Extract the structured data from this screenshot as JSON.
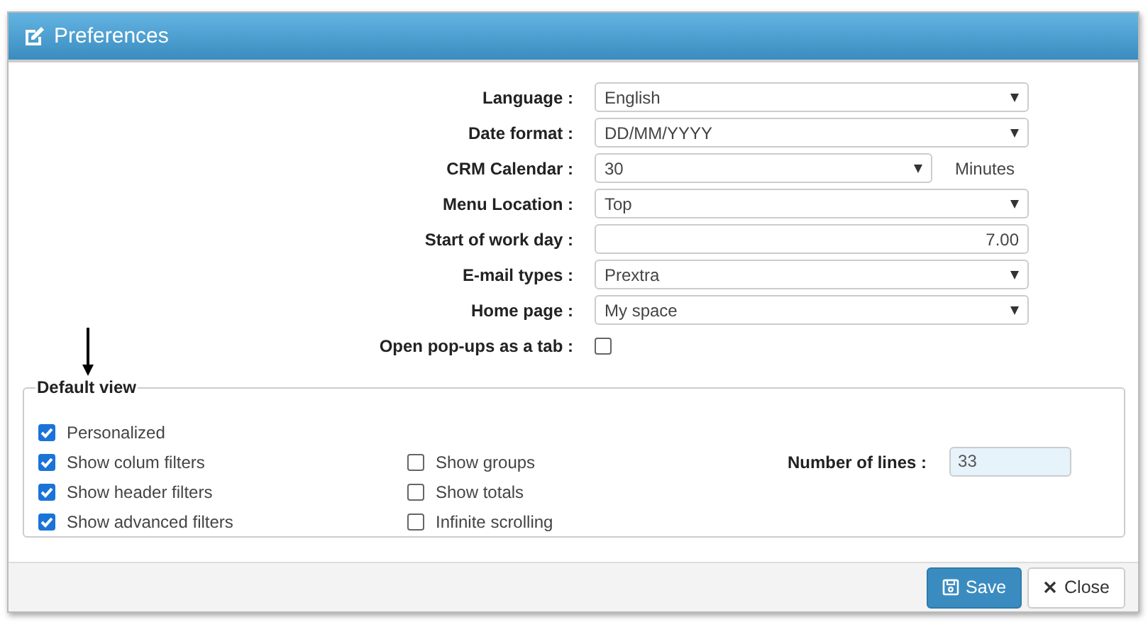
{
  "window": {
    "title": "Preferences"
  },
  "fields": [
    {
      "kind": "select",
      "label": "Language :",
      "value": "English"
    },
    {
      "kind": "select",
      "label": "Date format :",
      "value": "DD/MM/YYYY"
    },
    {
      "kind": "select",
      "label": "CRM Calendar :",
      "value": "30",
      "suffix": "Minutes"
    },
    {
      "kind": "select",
      "label": "Menu Location :",
      "value": "Top"
    },
    {
      "kind": "text",
      "label": "Start of work day :",
      "value": "7.00"
    },
    {
      "kind": "select",
      "label": "E-mail types :",
      "value": "Prextra"
    },
    {
      "kind": "select",
      "label": "Home page :",
      "value": "My space"
    },
    {
      "kind": "checkbox",
      "label": "Open pop-ups as a tab :",
      "checked": false
    }
  ],
  "default_view": {
    "title": "Default view",
    "column_1": [
      {
        "label": "Personalized",
        "checked": true
      },
      {
        "label": "Show colum filters",
        "checked": true
      },
      {
        "label": "Show header filters",
        "checked": true
      },
      {
        "label": "Show advanced filters",
        "checked": true
      }
    ],
    "column_2": [
      {
        "label": "Show groups",
        "checked": false
      },
      {
        "label": "Show totals",
        "checked": false
      },
      {
        "label": "Infinite scrolling",
        "checked": false
      }
    ],
    "number_of_lines": {
      "label": "Number of lines :",
      "value": "33"
    }
  },
  "buttons": [
    {
      "kind": "primary",
      "label": "Save"
    },
    {
      "kind": "close",
      "label": "Close"
    }
  ]
}
